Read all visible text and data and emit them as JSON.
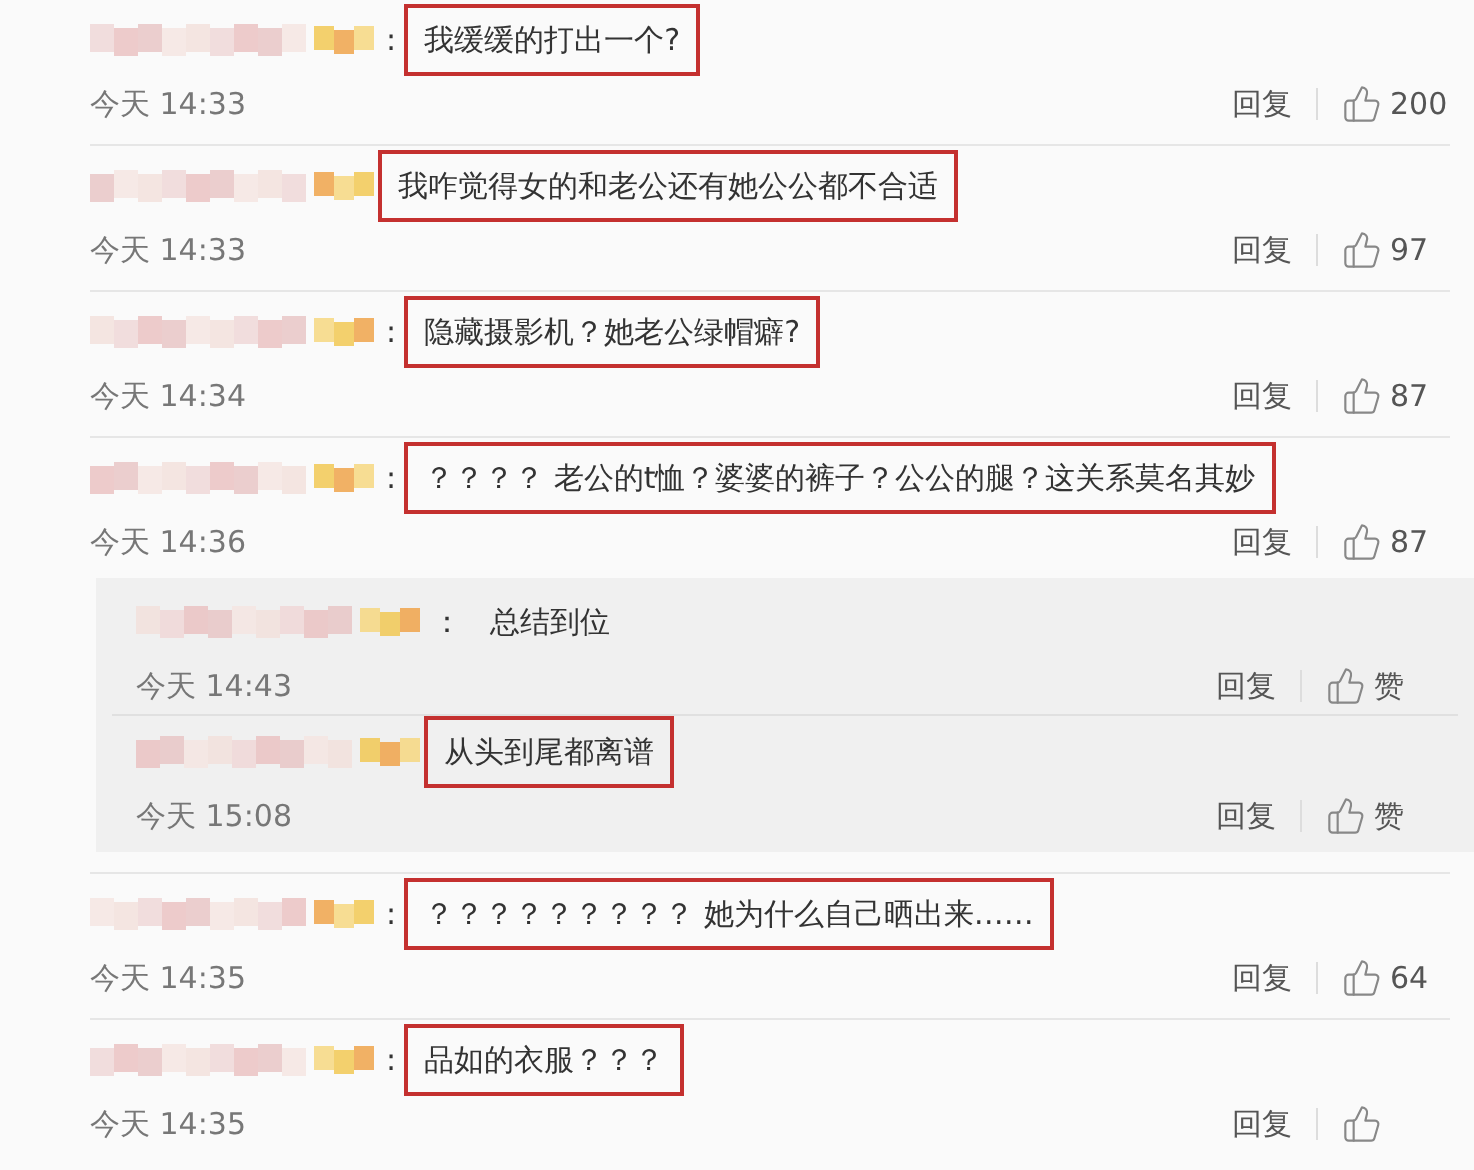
{
  "comments": [
    {
      "colon": ":",
      "text": "我缓缓的打出一个?",
      "highlighted": true,
      "time": "今天 14:33",
      "reply_label": "回复",
      "likes": "200"
    },
    {
      "text": "我咋觉得女的和老公还有她公公都不合适",
      "highlighted": true,
      "time": "今天 14:33",
      "reply_label": "回复",
      "likes": "97"
    },
    {
      "colon": ":",
      "text": "隐藏摄影机？她老公绿帽癖?",
      "highlighted": true,
      "time": "今天 14:34",
      "reply_label": "回复",
      "likes": "87"
    },
    {
      "colon": ":",
      "text": "？？？？ 老公的t恤？婆婆的裤子？公公的腿？这关系莫名其妙",
      "highlighted": true,
      "time": "今天 14:36",
      "reply_label": "回复",
      "likes": "87",
      "replies": [
        {
          "colon": "：",
          "text": "总结到位",
          "highlighted": false,
          "time": "今天 14:43",
          "reply_label": "回复",
          "likes": "赞"
        },
        {
          "text": "从头到尾都离谱",
          "highlighted": true,
          "time": "今天 15:08",
          "reply_label": "回复",
          "likes": "赞"
        }
      ]
    },
    {
      "colon": ":",
      "text": "？？？？？？？？？ 她为什么自己晒出来……",
      "highlighted": true,
      "time": "今天 14:35",
      "reply_label": "回复",
      "likes": "64"
    },
    {
      "colon": ":",
      "text": "品如的衣服？？？",
      "highlighted": true,
      "time": "今天 14:35",
      "reply_label": "回复"
    }
  ]
}
